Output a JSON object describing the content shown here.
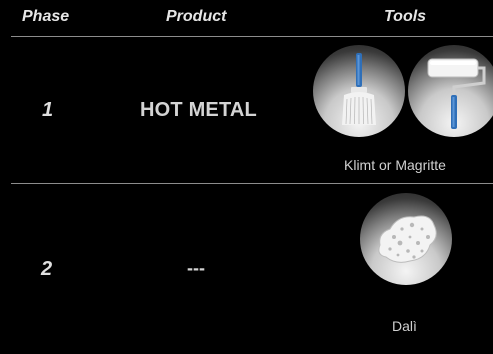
{
  "header": {
    "phase": "Phase",
    "product": "Product",
    "tools": "Tools"
  },
  "rows": [
    {
      "phase": "1",
      "product": "HOT METAL",
      "tools": [
        "paint-brush-icon",
        "paint-roller-icon"
      ],
      "tool_caption": "Klimt or Magritte"
    },
    {
      "phase": "2",
      "product": "---",
      "tools": [
        "sponge-icon"
      ],
      "tool_caption": "Dalì"
    }
  ],
  "colors": {
    "background": "#000000",
    "text": "#d9d9d9",
    "divider": "#8c8c8c",
    "tool_handle_blue": "#2f6fb8",
    "tool_circle_light": "#f4f4f4"
  }
}
